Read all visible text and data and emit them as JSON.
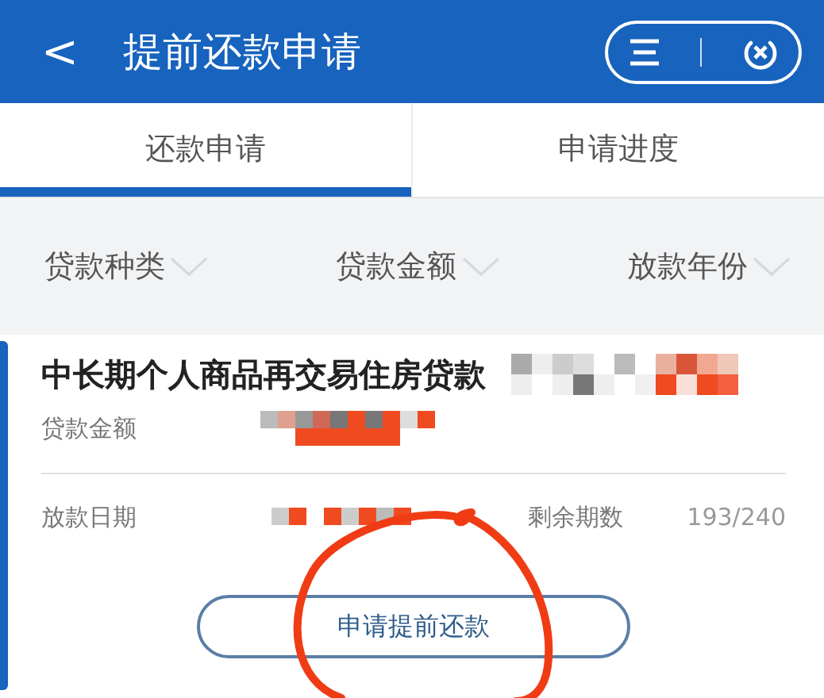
{
  "header": {
    "back": "<",
    "title": "提前还款申请"
  },
  "tabs": [
    {
      "label": "还款申请",
      "selected": true
    },
    {
      "label": "申请进度",
      "selected": false
    }
  ],
  "filters": [
    {
      "label": "贷款种类"
    },
    {
      "label": "贷款金额"
    },
    {
      "label": "放款年份"
    }
  ],
  "loan": {
    "title": "中长期个人商品再交易住房贷款",
    "amount_label": "贷款金额",
    "date_label": "放款日期",
    "remaining_label": "剩余期数",
    "remaining_value": "193/240",
    "button": "申请提前还款"
  }
}
